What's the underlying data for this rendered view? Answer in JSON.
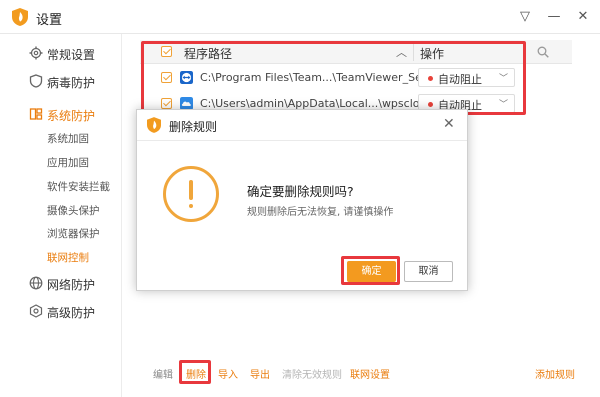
{
  "window": {
    "title": "设置",
    "controls": {
      "menu": "▽",
      "minimize": "—",
      "close": "✕"
    }
  },
  "sidebar": {
    "items": [
      {
        "label": "常规设置",
        "icon": "gear-icon"
      },
      {
        "label": "病毒防护",
        "icon": "shield-icon"
      },
      {
        "label": "系统防护",
        "icon": "system-icon",
        "active": true
      },
      {
        "label": "网络防护",
        "icon": "globe-icon"
      },
      {
        "label": "高级防护",
        "icon": "target-icon"
      }
    ],
    "sub_items": [
      {
        "label": "系统加固"
      },
      {
        "label": "应用加固"
      },
      {
        "label": "软件安装拦截"
      },
      {
        "label": "摄像头保护"
      },
      {
        "label": "浏览器保护"
      },
      {
        "label": "联网控制",
        "active": true
      }
    ]
  },
  "table": {
    "headers": {
      "path": "程序路径",
      "action": "操作"
    },
    "rows": [
      {
        "path": "C:\\Program Files\\Team...\\TeamViewer_Service.exe",
        "status": "自动阻止"
      },
      {
        "path": "C:\\Users\\admin\\AppData\\Local...\\wpscloudsvr.exe",
        "status": "自动阻止"
      }
    ]
  },
  "dialog": {
    "title": "删除规则",
    "message": "确定要删除规则吗?",
    "submessage": "规则删除后无法恢复, 请谨慎操作",
    "ok_label": "确定",
    "cancel_label": "取消"
  },
  "footer": {
    "edit": "编辑",
    "delete": "删除",
    "import": "导入",
    "export": "导出",
    "clear_invalid": "清除无效规则",
    "network_settings": "联网设置",
    "add_rule": "添加规则"
  },
  "colors": {
    "accent": "#ea7d0e",
    "warning": "#f0a63b",
    "highlight_box": "#e8383d",
    "status_dot": "#e8423a"
  }
}
